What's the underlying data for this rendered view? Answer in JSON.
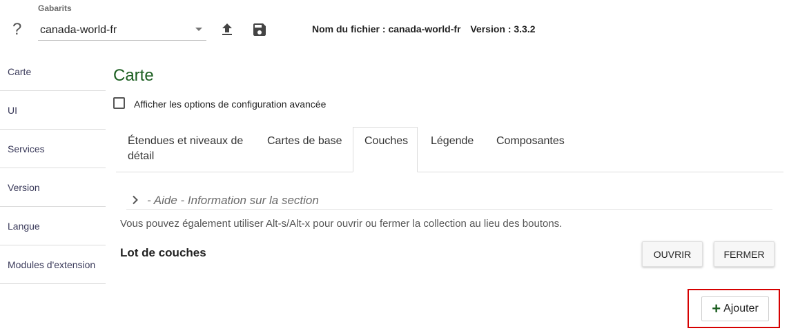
{
  "header": {
    "template_label": "Gabarits",
    "help_icon": "?",
    "template_value": "canada-world-fr",
    "upload_icon": "upload-icon",
    "save_icon": "save-icon",
    "file_name_text": "Nom du fichier : canada-world-fr",
    "version_text": "Version : 3.3.2"
  },
  "sidebar": {
    "items": [
      {
        "label": "Carte"
      },
      {
        "label": "UI"
      },
      {
        "label": "Services"
      },
      {
        "label": "Version"
      },
      {
        "label": "Langue"
      },
      {
        "label": "Modules d'extension"
      }
    ]
  },
  "main": {
    "title": "Carte",
    "advanced_option_label": "Afficher les options de configuration avancée",
    "tabs": [
      {
        "label_line1": "Étendues et niveaux de",
        "label_line2": "détail"
      },
      {
        "label": "Cartes de base"
      },
      {
        "label": "Couches",
        "active": true
      },
      {
        "label": "Légende"
      },
      {
        "label": "Composantes"
      }
    ],
    "help_section": "- Aide - Information sur la section",
    "tip_text": "Vous pouvez également utiliser Alt-s/Alt-x pour ouvrir ou fermer la collection au lieu des boutons.",
    "section_title": "Lot de couches",
    "open_label": "OUVRIR",
    "close_label": "FERMER",
    "add_label": "Ajouter",
    "add_plus": "+"
  },
  "colors": {
    "accent_green": "#1b5e20",
    "highlight_red": "#d60000"
  }
}
